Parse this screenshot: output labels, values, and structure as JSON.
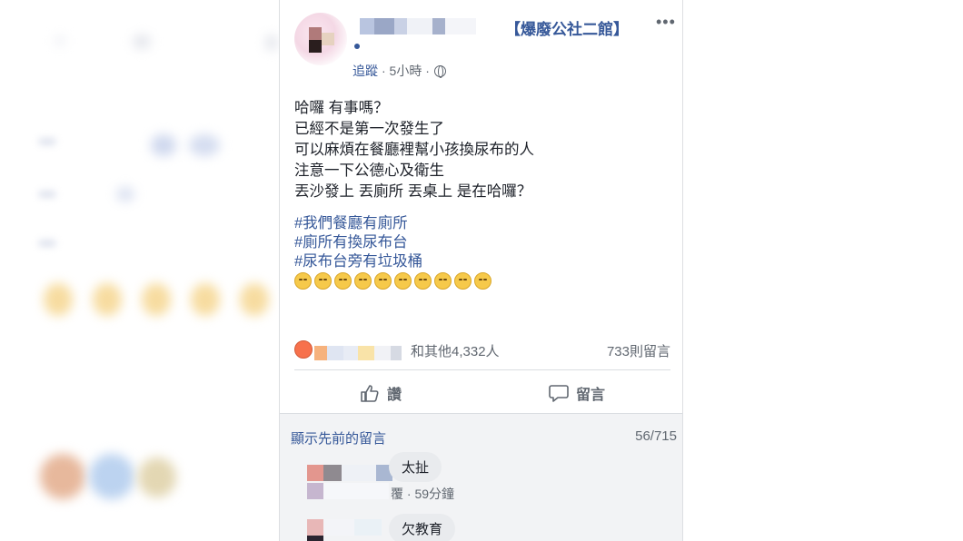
{
  "post": {
    "page_name": "【爆廢公社二館】",
    "more_label": "•••",
    "follow_label": "追蹤",
    "time_label": "· 5小時 ·",
    "body_lines": [
      "哈囉 有事嗎？",
      "已經不是第一次發生了",
      "可以麻煩在餐廳裡幫小孩換尿布的人",
      "注意一下公德心及衛生",
      "丟沙發上 丟廁所 丟桌上 是在哈囉？"
    ],
    "hashtags": [
      "#我們餐廳有廁所",
      "#廁所有換尿布台",
      "#尿布台旁有垃圾桶"
    ],
    "reactions_text": "和其他4,332人",
    "comments_count": "733則留言"
  },
  "actions": {
    "like_label": "讚",
    "comment_label": "留言"
  },
  "comments": {
    "prev_label": "顯示先前的留言",
    "pager": "56/715",
    "items": [
      {
        "text": "太扯",
        "meta": "覆 · 59分鐘"
      },
      {
        "text": "欠教育"
      }
    ]
  },
  "icons": {
    "more": "more-icon",
    "globe": "globe-icon",
    "like": "thumbs-up-icon",
    "comment": "comment-icon",
    "reaction": "angry-reaction-icon",
    "emoji": "rolling-eyes-emoji"
  },
  "colors": {
    "link": "#365899",
    "text": "#1d2129",
    "muted": "#606770",
    "comment_bg": "#f2f3f5"
  }
}
